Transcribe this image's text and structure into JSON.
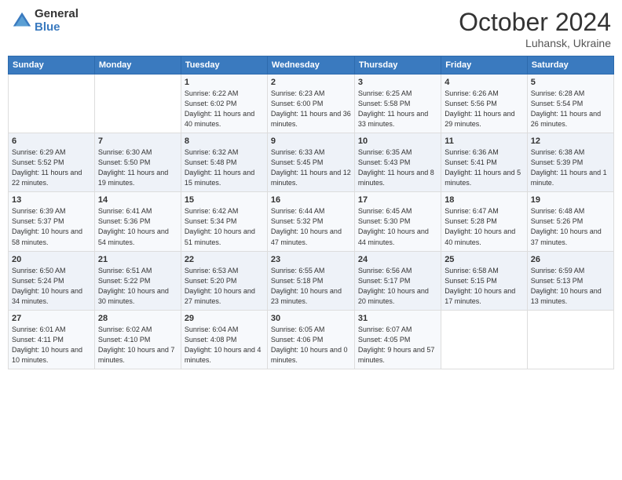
{
  "header": {
    "logo_general": "General",
    "logo_blue": "Blue",
    "month": "October 2024",
    "location": "Luhansk, Ukraine"
  },
  "weekdays": [
    "Sunday",
    "Monday",
    "Tuesday",
    "Wednesday",
    "Thursday",
    "Friday",
    "Saturday"
  ],
  "weeks": [
    [
      {
        "day": "",
        "info": ""
      },
      {
        "day": "",
        "info": ""
      },
      {
        "day": "1",
        "info": "Sunrise: 6:22 AM\nSunset: 6:02 PM\nDaylight: 11 hours and 40 minutes."
      },
      {
        "day": "2",
        "info": "Sunrise: 6:23 AM\nSunset: 6:00 PM\nDaylight: 11 hours and 36 minutes."
      },
      {
        "day": "3",
        "info": "Sunrise: 6:25 AM\nSunset: 5:58 PM\nDaylight: 11 hours and 33 minutes."
      },
      {
        "day": "4",
        "info": "Sunrise: 6:26 AM\nSunset: 5:56 PM\nDaylight: 11 hours and 29 minutes."
      },
      {
        "day": "5",
        "info": "Sunrise: 6:28 AM\nSunset: 5:54 PM\nDaylight: 11 hours and 26 minutes."
      }
    ],
    [
      {
        "day": "6",
        "info": "Sunrise: 6:29 AM\nSunset: 5:52 PM\nDaylight: 11 hours and 22 minutes."
      },
      {
        "day": "7",
        "info": "Sunrise: 6:30 AM\nSunset: 5:50 PM\nDaylight: 11 hours and 19 minutes."
      },
      {
        "day": "8",
        "info": "Sunrise: 6:32 AM\nSunset: 5:48 PM\nDaylight: 11 hours and 15 minutes."
      },
      {
        "day": "9",
        "info": "Sunrise: 6:33 AM\nSunset: 5:45 PM\nDaylight: 11 hours and 12 minutes."
      },
      {
        "day": "10",
        "info": "Sunrise: 6:35 AM\nSunset: 5:43 PM\nDaylight: 11 hours and 8 minutes."
      },
      {
        "day": "11",
        "info": "Sunrise: 6:36 AM\nSunset: 5:41 PM\nDaylight: 11 hours and 5 minutes."
      },
      {
        "day": "12",
        "info": "Sunrise: 6:38 AM\nSunset: 5:39 PM\nDaylight: 11 hours and 1 minute."
      }
    ],
    [
      {
        "day": "13",
        "info": "Sunrise: 6:39 AM\nSunset: 5:37 PM\nDaylight: 10 hours and 58 minutes."
      },
      {
        "day": "14",
        "info": "Sunrise: 6:41 AM\nSunset: 5:36 PM\nDaylight: 10 hours and 54 minutes."
      },
      {
        "day": "15",
        "info": "Sunrise: 6:42 AM\nSunset: 5:34 PM\nDaylight: 10 hours and 51 minutes."
      },
      {
        "day": "16",
        "info": "Sunrise: 6:44 AM\nSunset: 5:32 PM\nDaylight: 10 hours and 47 minutes."
      },
      {
        "day": "17",
        "info": "Sunrise: 6:45 AM\nSunset: 5:30 PM\nDaylight: 10 hours and 44 minutes."
      },
      {
        "day": "18",
        "info": "Sunrise: 6:47 AM\nSunset: 5:28 PM\nDaylight: 10 hours and 40 minutes."
      },
      {
        "day": "19",
        "info": "Sunrise: 6:48 AM\nSunset: 5:26 PM\nDaylight: 10 hours and 37 minutes."
      }
    ],
    [
      {
        "day": "20",
        "info": "Sunrise: 6:50 AM\nSunset: 5:24 PM\nDaylight: 10 hours and 34 minutes."
      },
      {
        "day": "21",
        "info": "Sunrise: 6:51 AM\nSunset: 5:22 PM\nDaylight: 10 hours and 30 minutes."
      },
      {
        "day": "22",
        "info": "Sunrise: 6:53 AM\nSunset: 5:20 PM\nDaylight: 10 hours and 27 minutes."
      },
      {
        "day": "23",
        "info": "Sunrise: 6:55 AM\nSunset: 5:18 PM\nDaylight: 10 hours and 23 minutes."
      },
      {
        "day": "24",
        "info": "Sunrise: 6:56 AM\nSunset: 5:17 PM\nDaylight: 10 hours and 20 minutes."
      },
      {
        "day": "25",
        "info": "Sunrise: 6:58 AM\nSunset: 5:15 PM\nDaylight: 10 hours and 17 minutes."
      },
      {
        "day": "26",
        "info": "Sunrise: 6:59 AM\nSunset: 5:13 PM\nDaylight: 10 hours and 13 minutes."
      }
    ],
    [
      {
        "day": "27",
        "info": "Sunrise: 6:01 AM\nSunset: 4:11 PM\nDaylight: 10 hours and 10 minutes."
      },
      {
        "day": "28",
        "info": "Sunrise: 6:02 AM\nSunset: 4:10 PM\nDaylight: 10 hours and 7 minutes."
      },
      {
        "day": "29",
        "info": "Sunrise: 6:04 AM\nSunset: 4:08 PM\nDaylight: 10 hours and 4 minutes."
      },
      {
        "day": "30",
        "info": "Sunrise: 6:05 AM\nSunset: 4:06 PM\nDaylight: 10 hours and 0 minutes."
      },
      {
        "day": "31",
        "info": "Sunrise: 6:07 AM\nSunset: 4:05 PM\nDaylight: 9 hours and 57 minutes."
      },
      {
        "day": "",
        "info": ""
      },
      {
        "day": "",
        "info": ""
      }
    ]
  ]
}
